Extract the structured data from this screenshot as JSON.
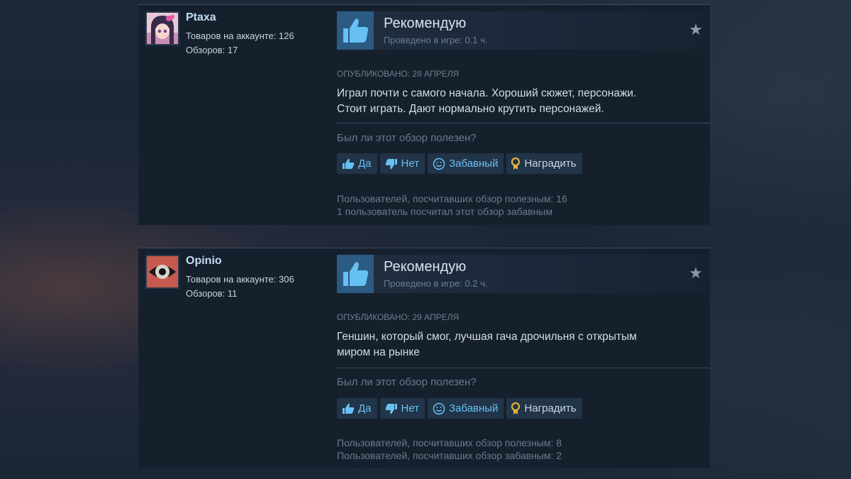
{
  "reviews": [
    {
      "author": {
        "name": "Ptaxa",
        "products_label": "Товаров на аккаунте: 126",
        "reviews_label": "Обзоров: 17",
        "avatar_icon": "anime-girl-avatar"
      },
      "verdict": "Рекомендую",
      "hours": "Проведено в игре: 0.1 ч.",
      "posted": "Опубликовано: 28 апреля",
      "text_line1": "Играл почти с самого начала. Хороший сюжет, персонажи.",
      "text_line2": "Стоит играть. Дают нормально крутить персонажей.",
      "helpful_question": "Был ли этот обзор полезен?",
      "buttons": {
        "yes": "Да",
        "no": "Нет",
        "funny": "Забавный",
        "award": "Наградить"
      },
      "found_helpful": "Пользователей, посчитавших обзор полезным: 16",
      "found_funny": "1 пользователь посчитал этот обзор забавным"
    },
    {
      "author": {
        "name": "Opinio",
        "products_label": "Товаров на аккаунте: 306",
        "reviews_label": "Обзоров: 11",
        "avatar_icon": "eye-avatar"
      },
      "verdict": "Рекомендую",
      "hours": "Проведено в игре: 0.2 ч.",
      "posted": "Опубликовано: 29 апреля",
      "text_line1": "Геншин, который смог, лучшая гача дрочильня с открытым",
      "text_line2": "миром на рынке",
      "helpful_question": "Был ли этот обзор полезен?",
      "buttons": {
        "yes": "Да",
        "no": "Нет",
        "funny": "Забавный",
        "award": "Наградить"
      },
      "found_helpful": "Пользователей, посчитавших обзор полезным: 8",
      "found_funny": "Пользователей, посчитавших обзор забавным: 2"
    }
  ],
  "colors": {
    "accent_link": "#67c1f5",
    "thumb_bg": "#2b5a82",
    "panel_bg": "#16202d",
    "award_gold": "#e3b33b"
  }
}
